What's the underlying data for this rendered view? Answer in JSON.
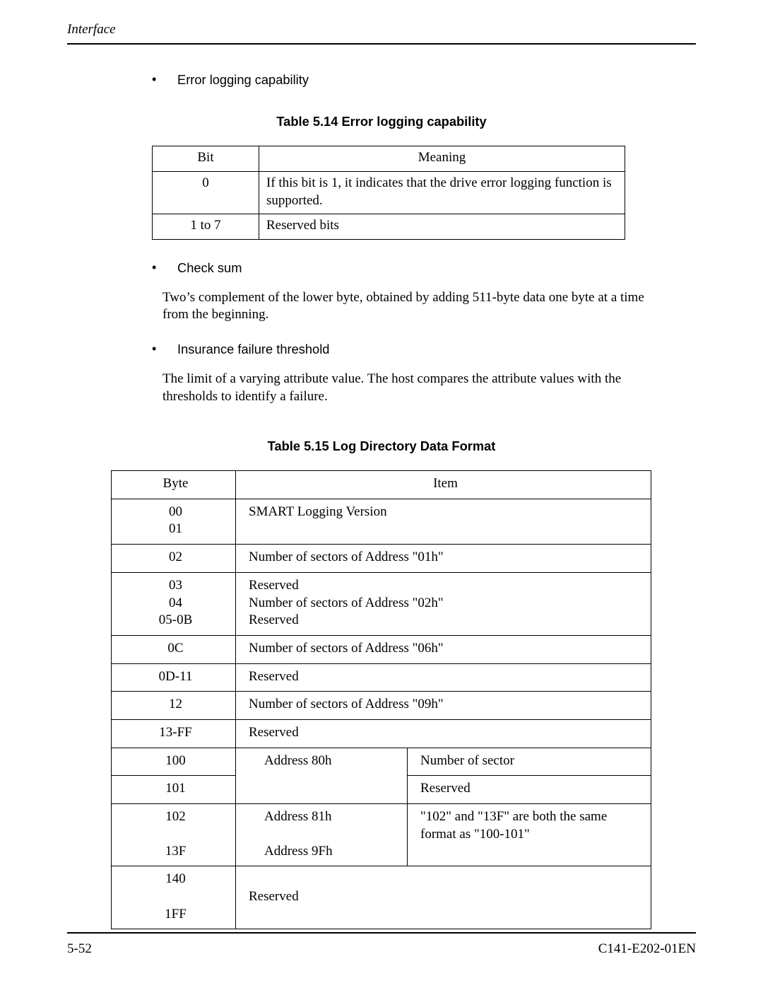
{
  "header": {
    "section": "Interface"
  },
  "bullets": {
    "b1": "Error logging capability",
    "b2": "Check sum",
    "b3": "Insurance failure threshold"
  },
  "captions": {
    "t514": "Table 5.14  Error logging capability",
    "t515": "Table 5.15  Log Directory Data Format"
  },
  "t514": {
    "head_bit": "Bit",
    "head_mean": "Meaning",
    "rows": [
      {
        "bit": "0",
        "mean": "If this bit is 1, it indicates that the drive error logging function is supported."
      },
      {
        "bit": "1 to 7",
        "mean": "Reserved bits"
      }
    ]
  },
  "paras": {
    "p1": "Two’s complement of the lower byte, obtained by adding 511-byte data one byte at a time from the beginning.",
    "p2": "The limit of a varying attribute value.  The host compares the attribute values with the thresholds to identify a failure."
  },
  "t515": {
    "head_byte": "Byte",
    "head_item": "Item",
    "r0_byte1": "00",
    "r0_byte2": "01",
    "r0_item": "SMART Logging Version",
    "r1_byte": "02",
    "r1_item": "Number of sectors of Address \"01h\"",
    "r2_byte1": "03",
    "r2_byte2": "04",
    "r2_byte3": "05-0B",
    "r2_item1": "Reserved",
    "r2_item2": "Number of sectors of Address \"02h\"",
    "r2_item3": "Reserved",
    "r3_byte": "0C",
    "r3_item": "Number of sectors of Address \"06h\"",
    "r4_byte": "0D-11",
    "r4_item": "Reserved",
    "r5_byte": "12",
    "r5_item": "Number of sectors of Address \"09h\"",
    "r6_byte": "13-FF",
    "r6_item": "Reserved",
    "r7_byte": "100",
    "r7_addr": "Address 80h",
    "r7_desc": "Number of sector",
    "r8_byte": "101",
    "r8_desc": "Reserved",
    "r9_byte": "102",
    "r9_addr": "Address 81h",
    "r9_desc": "\"102\" and \"13F\" are both the same format as \"100-101\"",
    "r10_byte": "13F",
    "r10_addr": "Address 9Fh",
    "r11_byte1": "140",
    "r11_byte2": "1FF",
    "r11_item": "Reserved"
  },
  "footer": {
    "left": "5-52",
    "right": "C141-E202-01EN"
  }
}
